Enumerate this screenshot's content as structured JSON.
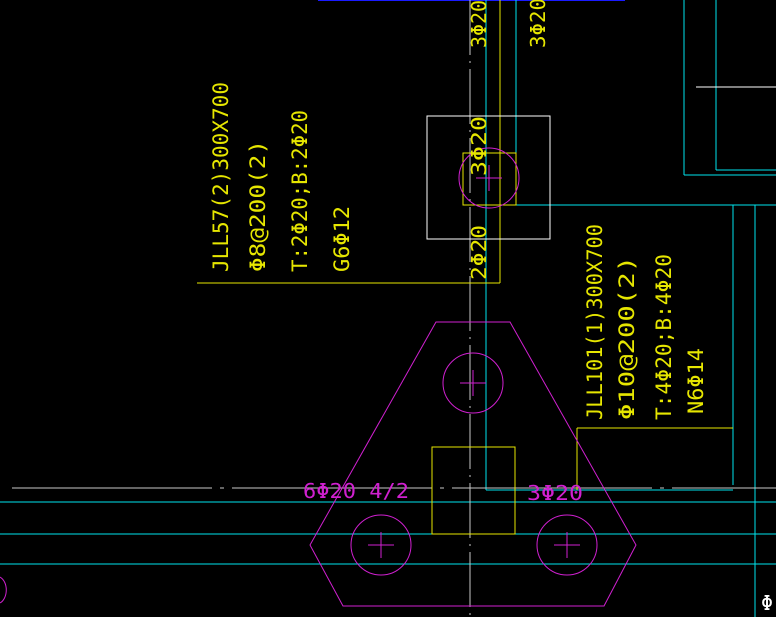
{
  "colors": {
    "background": "#000000",
    "beam_line": "#00e5ee",
    "annotation": "#e6e600",
    "pile": "#d020d0",
    "axis": "#c8c8c8",
    "blue_line": "#1a1aff",
    "white": "#ffffff"
  },
  "beam_jll57": {
    "line1": "JLL57(2)300X700",
    "line2": "Φ8@200(2)",
    "line3": "T:2Φ20;B:2Φ20",
    "line4": "G6Φ12"
  },
  "beam_jll101": {
    "line1": "JLL101(1)300X700",
    "line2": "Φ10@200(2)",
    "line3": "T:4Φ20;B:4Φ20",
    "line4": "N6Φ14"
  },
  "rebar": {
    "top_left": "3Φ20",
    "top_right": "3Φ20",
    "column_upper": "3Φ20",
    "column_lower": "2Φ20",
    "cap_left": "6Φ20 4/2",
    "cap_right": "3Φ20",
    "edge_right": "Φ"
  }
}
